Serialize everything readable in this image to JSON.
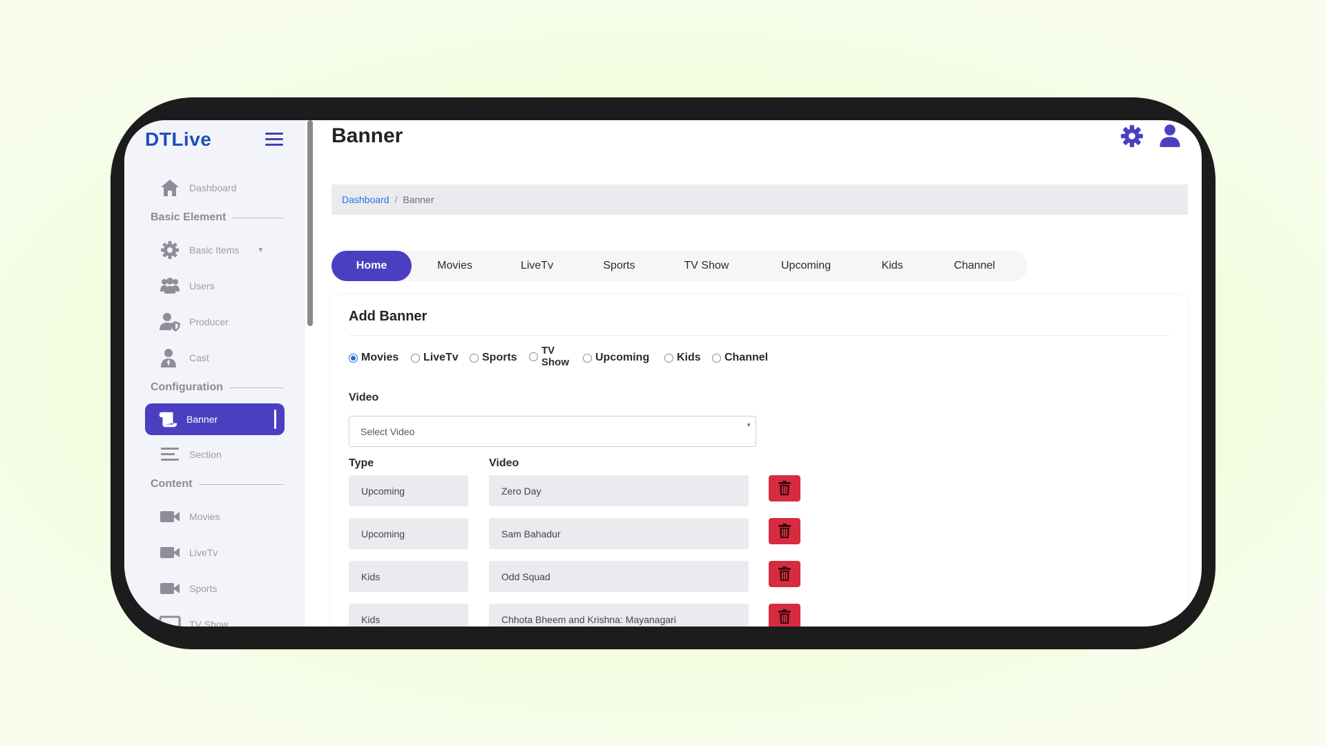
{
  "app": {
    "logo": "DTLive"
  },
  "sidebar": {
    "dashboard": "Dashboard",
    "sections": {
      "basic": "Basic Element",
      "configuration": "Configuration",
      "content": "Content"
    },
    "basic_items": "Basic Items",
    "users": "Users",
    "producer": "Producer",
    "cast": "Cast",
    "banner": "Banner",
    "section": "Section",
    "movies": "Movies",
    "livetv": "LiveTv",
    "sports": "Sports",
    "tvshow_partial": "TV Show"
  },
  "header": {
    "title": "Banner"
  },
  "breadcrumb": {
    "link": "Dashboard",
    "separator": "/",
    "current": "Banner"
  },
  "tabs": [
    "Home",
    "Movies",
    "LiveTv",
    "Sports",
    "TV Show",
    "Upcoming",
    "Kids",
    "Channel"
  ],
  "active_tab": "Home",
  "form": {
    "title": "Add Banner",
    "radio_options": [
      "Movies",
      "LiveTv",
      "Sports",
      "TV Show",
      "Upcoming",
      "Kids",
      "Channel"
    ],
    "selected_radio": "Movies",
    "video_label": "Video",
    "select_placeholder": "Select Video",
    "type_header": "Type",
    "video_header": "Video",
    "rows": [
      {
        "type": "Upcoming",
        "video": "Zero Day"
      },
      {
        "type": "Upcoming",
        "video": "Sam Bahadur"
      },
      {
        "type": "Kids",
        "video": "Odd Squad"
      },
      {
        "type": "Kids",
        "video": "Chhota Bheem and Krishna: Mayanagari"
      }
    ]
  },
  "colors": {
    "accent": "#4b3fc1",
    "logo": "#1d4fb8",
    "link": "#2e6fe0",
    "delete": "#d72b3f",
    "device": "#1c1c1c",
    "sidebar_bg": "#f3f4fa"
  }
}
